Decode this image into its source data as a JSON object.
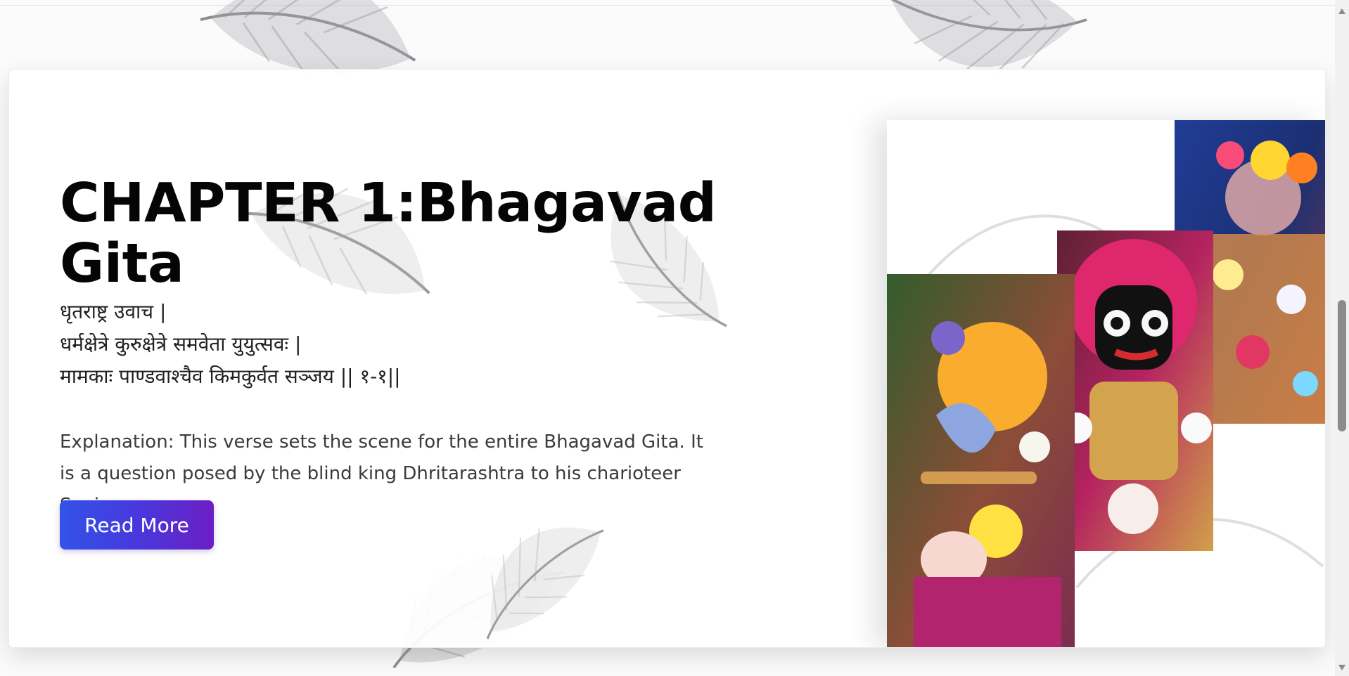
{
  "chapter": {
    "title": "CHAPTER 1:Bhagavad Gita",
    "verse_lines": [
      "धृतराष्ट्र उवाच |",
      "धर्मक्षेत्रे कुरुक्षेत्रे समवेता युयुत्सवः |",
      "मामकाः पाण्डवाश्चैव किमकुर्वत सञ्जय || १-१||"
    ],
    "explanation": "Explanation: This verse sets the scene for the entire Bhagavad Gita. It is a question posed by the blind king Dhritarashtra to his charioteer Sanjaya.",
    "read_more_label": "Read More"
  },
  "colors": {
    "button_gradient": [
      "#3253e8",
      "#4838dd",
      "#6b1fc4"
    ],
    "title": "#050505",
    "body_text": "#3a3a3f"
  },
  "icons": [
    "feather-decoration-icon",
    "scroll-up-arrow-icon",
    "scroll-down-arrow-icon"
  ]
}
